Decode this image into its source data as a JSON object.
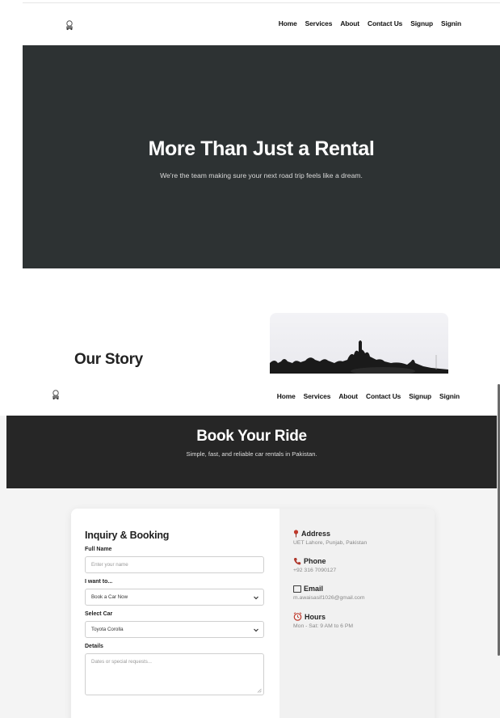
{
  "about_page": {
    "nav": [
      "Home",
      "Services",
      "About",
      "Contact Us",
      "Signup",
      "Signin"
    ],
    "hero": {
      "title": "More Than Just a Rental",
      "subtitle": "We're the team making sure your next road trip feels like a dream."
    },
    "story": {
      "title": "Our Story"
    },
    "colors": {
      "hero_bg": "#2d3233"
    }
  },
  "booking_page": {
    "nav": [
      "Home",
      "Services",
      "About",
      "Contact Us",
      "Signup",
      "Signin"
    ],
    "hero": {
      "title": "Book Your Ride",
      "subtitle": "Simple, fast, and reliable car rentals in Pakistan."
    },
    "form": {
      "title": "Inquiry & Booking",
      "full_name": {
        "label": "Full Name",
        "placeholder": "Enter your name"
      },
      "intent": {
        "label": "I want to...",
        "selected": "Book a Car Now"
      },
      "car": {
        "label": "Select Car",
        "selected": "Toyota Corolla"
      },
      "details": {
        "label": "Details",
        "placeholder": "Dates or special requests..."
      }
    },
    "info": {
      "address": {
        "label": "Address",
        "value": "UET Lahore, Punjab, Pakistan",
        "icon": "pin-icon"
      },
      "phone": {
        "label": "Phone",
        "value": "+92 316 7090127",
        "icon": "phone-icon"
      },
      "email": {
        "label": "Email",
        "value": "m.awaisasif1026@gmail.com",
        "icon": "email-icon"
      },
      "hours": {
        "label": "Hours",
        "value": "Mon - Sat: 9 AM to 6 PM",
        "icon": "clock-icon"
      }
    },
    "colors": {
      "hero_bg": "#262626",
      "pin": "#c0392b",
      "phone": "#b03a2e",
      "clock": "#c0392b"
    }
  }
}
